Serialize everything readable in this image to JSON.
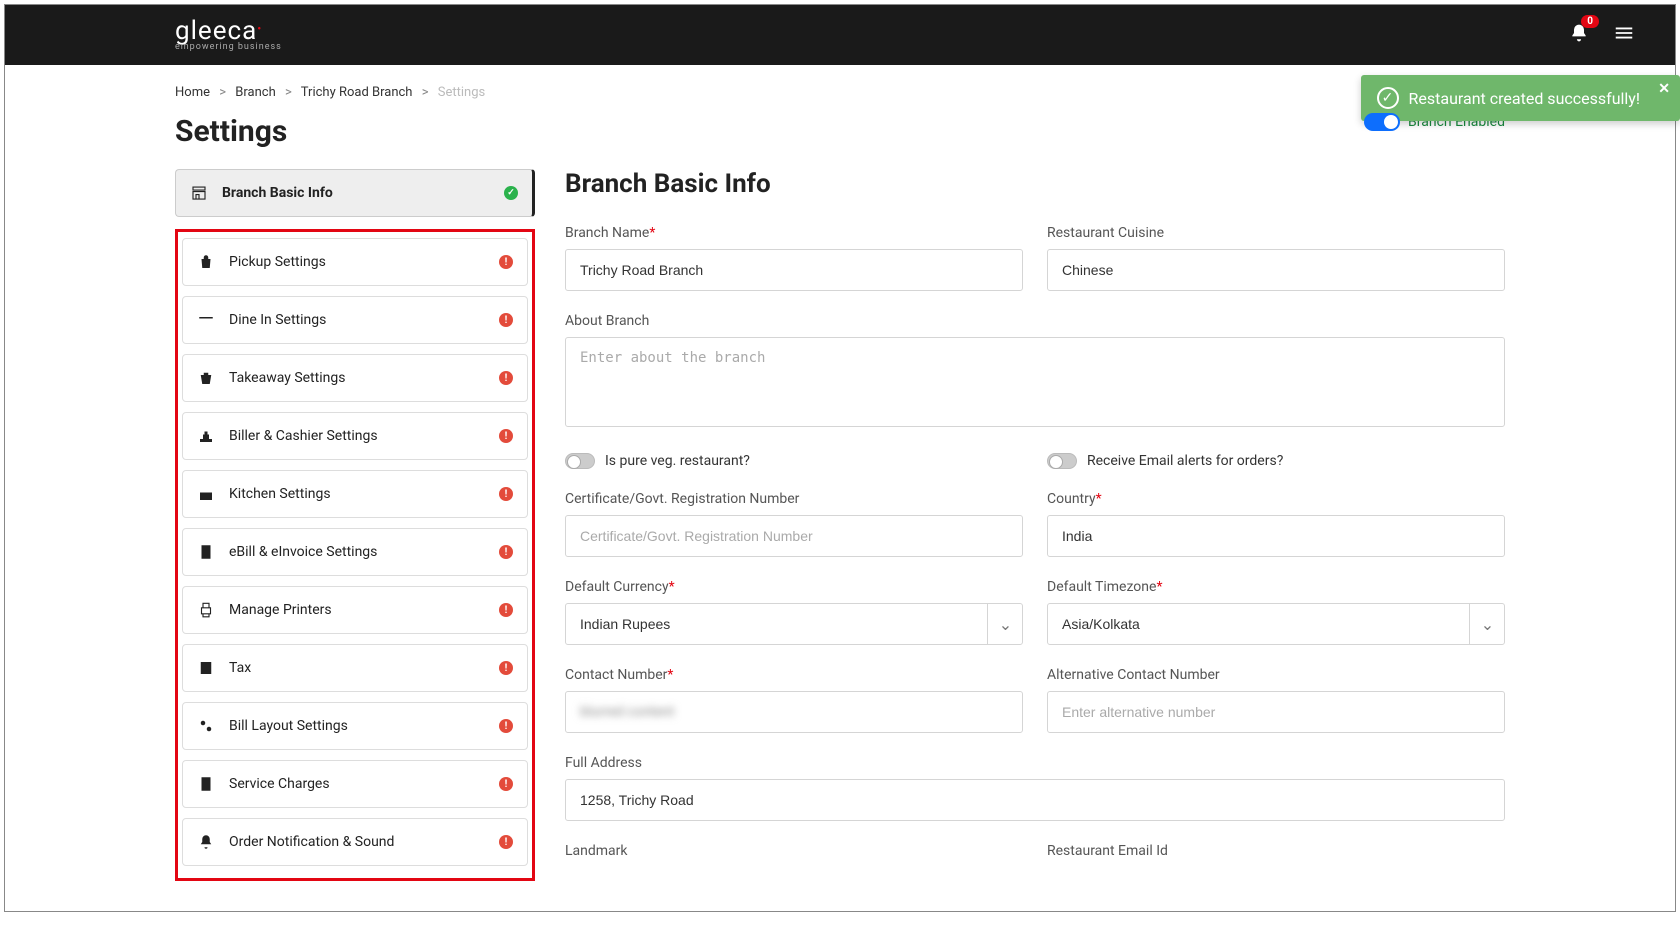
{
  "brand": {
    "name": "gleeca",
    "tagline": "empowering business"
  },
  "notification_count": "0",
  "toast": {
    "message": "Restaurant created successfully!"
  },
  "breadcrumb": {
    "home": "Home",
    "branch": "Branch",
    "branch_name": "Trichy Road Branch",
    "current": "Settings"
  },
  "page_title": "Settings",
  "branch_enabled_label": "Branch Enabled",
  "sidebar": {
    "items": [
      {
        "label": "Branch Basic Info",
        "status": "ok"
      },
      {
        "label": "Pickup Settings",
        "status": "warn"
      },
      {
        "label": "Dine In Settings",
        "status": "warn"
      },
      {
        "label": "Takeaway Settings",
        "status": "warn"
      },
      {
        "label": "Biller & Cashier Settings",
        "status": "warn"
      },
      {
        "label": "Kitchen Settings",
        "status": "warn"
      },
      {
        "label": "eBill & eInvoice Settings",
        "status": "warn"
      },
      {
        "label": "Manage Printers",
        "status": "warn"
      },
      {
        "label": "Tax",
        "status": "warn"
      },
      {
        "label": "Bill Layout Settings",
        "status": "warn"
      },
      {
        "label": "Service Charges",
        "status": "warn"
      },
      {
        "label": "Order Notification & Sound",
        "status": "warn"
      }
    ]
  },
  "form": {
    "section_title": "Branch Basic Info",
    "branch_name": {
      "label": "Branch Name",
      "value": "Trichy Road Branch"
    },
    "cuisine": {
      "label": "Restaurant Cuisine",
      "value": "Chinese"
    },
    "about": {
      "label": "About Branch",
      "placeholder": "Enter about the branch",
      "value": ""
    },
    "pure_veg": {
      "label": "Is pure veg. restaurant?"
    },
    "email_alerts": {
      "label": "Receive Email alerts for orders?"
    },
    "cert": {
      "label": "Certificate/Govt. Registration Number",
      "placeholder": "Certificate/Govt. Registration Number",
      "value": ""
    },
    "country": {
      "label": "Country",
      "value": "India"
    },
    "currency": {
      "label": "Default Currency",
      "value": "Indian Rupees"
    },
    "timezone": {
      "label": "Default Timezone",
      "value": "Asia/Kolkata"
    },
    "contact": {
      "label": "Contact Number",
      "value": "blurred content"
    },
    "alt_contact": {
      "label": "Alternative Contact Number",
      "placeholder": "Enter alternative number",
      "value": ""
    },
    "address": {
      "label": "Full Address",
      "value": "1258, Trichy Road"
    },
    "landmark": {
      "label": "Landmark"
    },
    "email": {
      "label": "Restaurant Email Id"
    }
  }
}
